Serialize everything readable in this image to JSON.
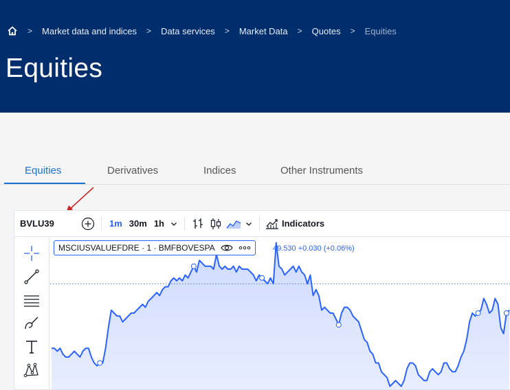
{
  "breadcrumb": {
    "items": [
      "Market data and indices",
      "Data services",
      "Market Data",
      "Quotes"
    ],
    "current": "Equities"
  },
  "page": {
    "title": "Equities"
  },
  "tabs": [
    {
      "label": "Equities",
      "active": true
    },
    {
      "label": "Derivatives",
      "active": false
    },
    {
      "label": "Indices",
      "active": false
    },
    {
      "label": "Other Instruments",
      "active": false
    }
  ],
  "chart_widget": {
    "symbol": "BVLU39",
    "intervals": [
      "1m",
      "30m",
      "1h"
    ],
    "selected_interval": "1m",
    "indicators_label": "Indicators",
    "legend_title": "MSCIUSVALUEFDRE · 1 · BMFBOVESPA",
    "price_readout": "49.530 +0.030 (+0.06%)",
    "icons": {
      "add": "plus-circle-icon",
      "interval_menu": "chevron-down-icon",
      "bar_style": "bar-chart-icon",
      "candle_style": "candlestick-icon",
      "area_style": "area-chart-icon",
      "indicators": "indicators-icon",
      "visibility": "eye-icon",
      "more": "more-dots-icon"
    },
    "drawing_tools": [
      "crosshair-icon",
      "trend-line-icon",
      "horizontal-lines-icon",
      "brush-icon",
      "text-icon",
      "pattern-icon"
    ]
  },
  "colors": {
    "header_bg": "#002d6b",
    "accent": "#1a6fd0",
    "chart_line": "#2962ff",
    "annotation_arrow": "#c62828"
  },
  "chart_data": {
    "type": "area",
    "series": [
      {
        "values": [
          49.38,
          49.38,
          49.37,
          49.38,
          49.36,
          49.35,
          49.35,
          49.36,
          49.37,
          49.36,
          49.35,
          49.37,
          49.38,
          49.38,
          49.35,
          49.33,
          49.32,
          49.33,
          49.33,
          49.38,
          49.45,
          49.51,
          49.5,
          49.49,
          49.49,
          49.47,
          49.48,
          49.49,
          49.5,
          49.5,
          49.51,
          49.52,
          49.53,
          49.52,
          49.54,
          49.55,
          49.56,
          49.57,
          49.56,
          49.58,
          49.59,
          49.59,
          49.61,
          49.62,
          49.61,
          49.62,
          49.61,
          49.63,
          49.62,
          49.64,
          49.66,
          49.64,
          49.68,
          49.67,
          49.66,
          49.66,
          49.66,
          49.65,
          49.7,
          49.66,
          49.65,
          49.66,
          49.65,
          49.65,
          49.66,
          49.64,
          49.66,
          49.65,
          49.65,
          49.65,
          49.64,
          49.63,
          49.61,
          49.63,
          49.62,
          49.61,
          49.6,
          49.62,
          49.6,
          49.74,
          49.66,
          49.65,
          49.63,
          49.64,
          49.65,
          49.66,
          49.64,
          49.66,
          49.64,
          49.63,
          49.6,
          49.63,
          49.56,
          49.58,
          49.56,
          49.51,
          49.52,
          49.51,
          49.5,
          49.5,
          49.48,
          49.46,
          49.5,
          49.52,
          49.52,
          49.51,
          49.49,
          49.48,
          49.47,
          49.44,
          49.41,
          49.4,
          49.37,
          49.36,
          49.33,
          49.33,
          49.3,
          49.29,
          49.28,
          49.25,
          49.26,
          49.27,
          49.26,
          49.25,
          49.27,
          49.31,
          49.33,
          49.33,
          49.32,
          49.29,
          49.28,
          49.27,
          49.27,
          49.3,
          49.31,
          49.3,
          49.29,
          49.3,
          49.33,
          49.33,
          49.31,
          49.3,
          49.3,
          49.32,
          49.35,
          49.37,
          49.41,
          49.47,
          49.5,
          49.49,
          49.5,
          49.51,
          49.55,
          49.53,
          49.5,
          49.51,
          49.55,
          49.53,
          49.45,
          49.43,
          49.5,
          49.51
        ]
      }
    ],
    "last_price": 49.53,
    "ylim": [
      49.24,
      49.76
    ],
    "price_line": 49.6,
    "markers_at_index": [
      17,
      50,
      74,
      101,
      150,
      160
    ],
    "grid": false,
    "legend": "top-left"
  }
}
